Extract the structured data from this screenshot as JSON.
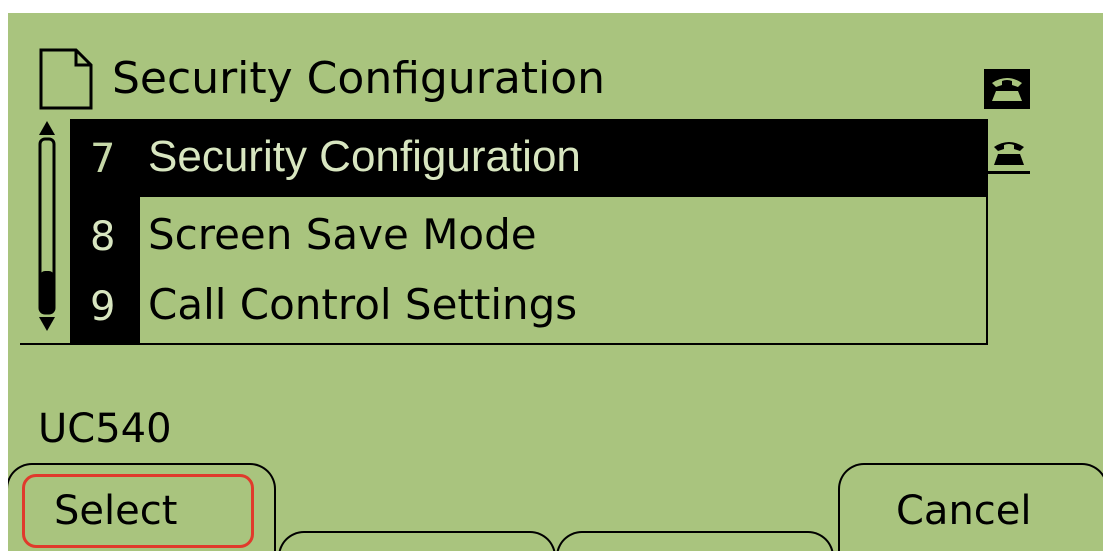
{
  "header": {
    "title": "Security Configuration",
    "icon": "document-icon"
  },
  "line_icons": [
    "phone-line-icon",
    "phone-line-icon"
  ],
  "menu": {
    "items": [
      {
        "number": "7",
        "label": "Security Configuration",
        "selected": true
      },
      {
        "number": "8",
        "label": "Screen Save Mode",
        "selected": false
      },
      {
        "number": "9",
        "label": "Call Control Settings",
        "selected": false
      }
    ]
  },
  "footer": {
    "model": "UC540"
  },
  "softkeys": {
    "left_label": "Select",
    "right_label": "Cancel"
  },
  "colors": {
    "screen_background": "#a9c47e",
    "highlight": "#000000",
    "focus_outline": "#e03a2c"
  }
}
